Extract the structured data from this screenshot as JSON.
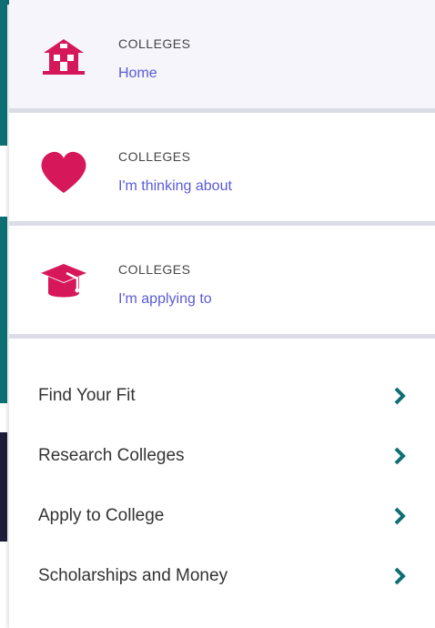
{
  "colors": {
    "accent_pink": "#d6185a",
    "link_purple": "#5b5bd6",
    "teal": "#0d6f73",
    "divider": "#dcdce6"
  },
  "college_cards": [
    {
      "eyebrow": "COLLEGES",
      "link": "Home",
      "icon": "house-icon"
    },
    {
      "eyebrow": "COLLEGES",
      "link": "I'm thinking about",
      "icon": "heart-icon"
    },
    {
      "eyebrow": "COLLEGES",
      "link": "I'm applying to",
      "icon": "graduation-cap-icon"
    }
  ],
  "nav_items": [
    {
      "label": "Find Your Fit",
      "icon": "chevron-right-icon"
    },
    {
      "label": "Research Colleges",
      "icon": "chevron-right-icon"
    },
    {
      "label": "Apply to College",
      "icon": "chevron-right-icon"
    },
    {
      "label": "Scholarships and Money",
      "icon": "chevron-right-icon"
    }
  ]
}
